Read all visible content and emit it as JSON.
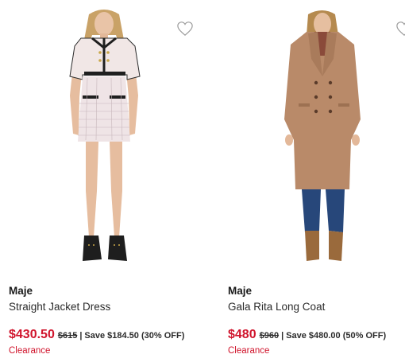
{
  "products": [
    {
      "brand": "Maje",
      "name": "Straight Jacket Dress",
      "sale_price": "$430.50",
      "original_price": "$615",
      "separator": "|",
      "savings": "Save $184.50 (30% OFF)",
      "badge": "Clearance",
      "favorite_icon": "heart-outline-icon"
    },
    {
      "brand": "Maje",
      "name": "Gala Rita Long Coat",
      "sale_price": "$480",
      "original_price": "$960",
      "separator": "|",
      "savings": "Save $480.00 (50% OFF)",
      "badge": "Clearance",
      "favorite_icon": "heart-outline-icon"
    }
  ],
  "colors": {
    "sale_price": "#d0142c",
    "text": "#1a1a1a"
  }
}
